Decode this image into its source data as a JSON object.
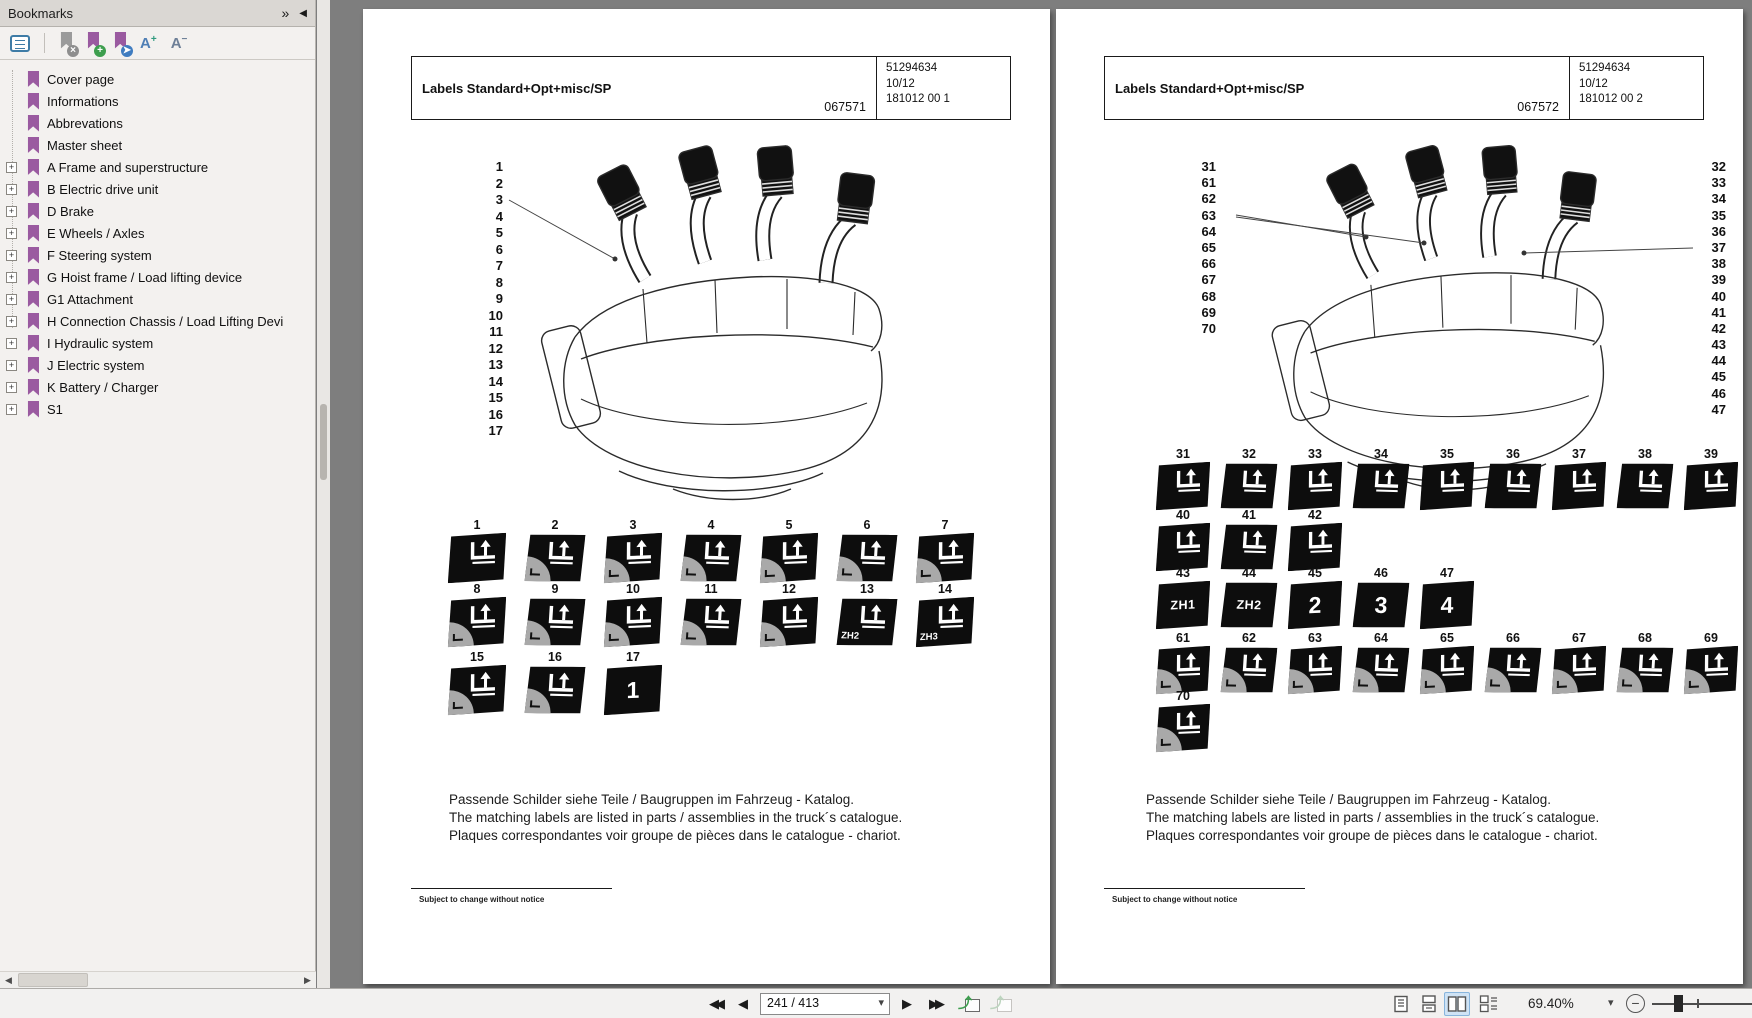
{
  "icons": {
    "panel_expand": "»",
    "panel_collapse": "◀",
    "expander_plus": "+",
    "scroll_left": "◀",
    "scroll_right": "▶",
    "nav_first": "◀◀",
    "nav_prev": "◀",
    "nav_next": "▶",
    "nav_last": "▶▶",
    "caret_down": "▾",
    "zoom_minus": "−",
    "hist_arrow": "⤴",
    "font_larger_letter": "A",
    "font_larger_sign": "+",
    "font_smaller_letter": "A",
    "font_smaller_sign": "−"
  },
  "sidebar": {
    "title": "Bookmarks",
    "items": [
      {
        "label": "Cover page",
        "expandable": false
      },
      {
        "label": "Informations",
        "expandable": false
      },
      {
        "label": "Abbrevations",
        "expandable": false
      },
      {
        "label": "Master sheet",
        "expandable": false
      },
      {
        "label": "A Frame and superstructure",
        "expandable": true
      },
      {
        "label": "B Electric drive unit",
        "expandable": true
      },
      {
        "label": "D Brake",
        "expandable": true
      },
      {
        "label": "E Wheels / Axles",
        "expandable": true
      },
      {
        "label": "F Steering system",
        "expandable": true
      },
      {
        "label": "G Hoist frame / Load lifting device",
        "expandable": true
      },
      {
        "label": "G1 Attachment",
        "expandable": true
      },
      {
        "label": "H Connection Chassis / Load Lifting Devi",
        "expandable": true
      },
      {
        "label": "I Hydraulic system",
        "expandable": true
      },
      {
        "label": "J Electric system",
        "expandable": true
      },
      {
        "label": "K Battery / Charger",
        "expandable": true
      },
      {
        "label": "S1",
        "expandable": true
      }
    ]
  },
  "pages": [
    {
      "header": {
        "title": "Labels Standard+Opt+misc/SP",
        "code": "067571",
        "right_lines": [
          "51294634",
          "10/12",
          "181012 00 1"
        ]
      },
      "left_numbers": [
        "1",
        "2",
        "3",
        "4",
        "5",
        "6",
        "7",
        "8",
        "9",
        "10",
        "11",
        "12",
        "13",
        "14",
        "15",
        "16",
        "17"
      ],
      "rows": [
        {
          "items": [
            {
              "num": "1",
              "variant": "solid"
            },
            {
              "num": "2",
              "variant": "corner"
            },
            {
              "num": "3",
              "variant": "corner"
            },
            {
              "num": "4",
              "variant": "corner"
            },
            {
              "num": "5",
              "variant": "corner"
            },
            {
              "num": "6",
              "variant": "corner"
            },
            {
              "num": "7",
              "variant": "corner"
            }
          ]
        },
        {
          "items": [
            {
              "num": "8",
              "variant": "corner"
            },
            {
              "num": "9",
              "variant": "corner"
            },
            {
              "num": "10",
              "variant": "corner"
            },
            {
              "num": "11",
              "variant": "corner"
            },
            {
              "num": "12",
              "variant": "corner"
            },
            {
              "num": "13",
              "variant": "glyph-text",
              "text": "ZH2"
            },
            {
              "num": "14",
              "variant": "glyph-text",
              "text": "ZH3"
            }
          ]
        },
        {
          "items": [
            {
              "num": "15",
              "variant": "corner"
            },
            {
              "num": "16",
              "variant": "corner"
            },
            {
              "num": "17",
              "variant": "text",
              "text": "1"
            }
          ]
        }
      ],
      "notes": [
        "Passende Schilder siehe Teile / Baugruppen im Fahrzeug - Katalog.",
        "The matching labels are listed in parts / assemblies in the truck´s catalogue.",
        "Plaques correspondantes voir groupe de pièces dans le catalogue - chariot."
      ],
      "footer_note": "Subject to change without notice"
    },
    {
      "header": {
        "title": "Labels Standard+Opt+misc/SP",
        "code": "067572",
        "right_lines": [
          "51294634",
          "10/12",
          "181012 00 2"
        ]
      },
      "left_numbers": [
        "31",
        "61",
        "62",
        "63",
        "64",
        "65",
        "66",
        "67",
        "68",
        "69",
        "70"
      ],
      "right_numbers": [
        "32",
        "33",
        "34",
        "35",
        "36",
        "37",
        "38",
        "39",
        "40",
        "41",
        "42",
        "43",
        "44",
        "45",
        "46",
        "47"
      ],
      "rows": [
        {
          "items": [
            {
              "num": "31",
              "variant": "solid"
            },
            {
              "num": "32",
              "variant": "solid"
            },
            {
              "num": "33",
              "variant": "solid"
            },
            {
              "num": "34",
              "variant": "solid"
            },
            {
              "num": "35",
              "variant": "solid"
            },
            {
              "num": "36",
              "variant": "solid"
            },
            {
              "num": "37",
              "variant": "solid"
            },
            {
              "num": "38",
              "variant": "solid"
            },
            {
              "num": "39",
              "variant": "solid"
            }
          ]
        },
        {
          "items": [
            {
              "num": "40",
              "variant": "solid"
            },
            {
              "num": "41",
              "variant": "solid"
            },
            {
              "num": "42",
              "variant": "solid"
            }
          ]
        },
        {
          "items": [
            {
              "num": "43",
              "variant": "text-sm",
              "text": "ZH1"
            },
            {
              "num": "44",
              "variant": "text-sm",
              "text": "ZH2"
            },
            {
              "num": "45",
              "variant": "text",
              "text": "2"
            },
            {
              "num": "46",
              "variant": "text",
              "text": "3"
            },
            {
              "num": "47",
              "variant": "text",
              "text": "4"
            }
          ]
        },
        {
          "items": [
            {
              "num": "61",
              "variant": "corner"
            },
            {
              "num": "62",
              "variant": "corner"
            },
            {
              "num": "63",
              "variant": "corner"
            },
            {
              "num": "64",
              "variant": "corner"
            },
            {
              "num": "65",
              "variant": "corner"
            },
            {
              "num": "66",
              "variant": "corner"
            },
            {
              "num": "67",
              "variant": "corner"
            },
            {
              "num": "68",
              "variant": "corner"
            },
            {
              "num": "69",
              "variant": "corner"
            }
          ]
        },
        {
          "items": [
            {
              "num": "70",
              "variant": "corner"
            }
          ]
        }
      ],
      "notes": [
        "Passende Schilder siehe Teile / Baugruppen im Fahrzeug - Katalog.",
        "The matching labels are listed in parts / assemblies in the truck´s catalogue.",
        "Plaques correspondantes voir groupe de pièces dans le catalogue - chariot."
      ],
      "footer_note": "Subject to change without notice"
    }
  ],
  "bottom_toolbar": {
    "page_value": "241 / 413",
    "zoom_value": "69.40%"
  }
}
